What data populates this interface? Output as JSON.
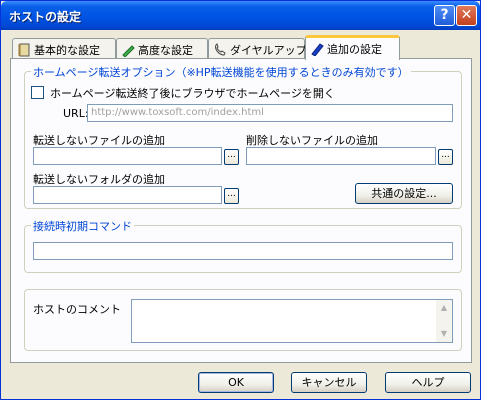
{
  "window": {
    "title": "ホストの設定",
    "help_button": "?",
    "close_button": "✕"
  },
  "tabs": [
    {
      "label": "基本的な設定",
      "icon": "book-icon"
    },
    {
      "label": "高度な設定",
      "icon": "pen-icon"
    },
    {
      "label": "ダイヤルアップ",
      "icon": "phone-icon"
    },
    {
      "label": "追加の設定",
      "icon": "pencil-icon",
      "active": true
    }
  ],
  "hp_group": {
    "label": "ホームページ転送オプション（※HP転送機能を使用するときのみ有効です）",
    "checkbox_label": "ホームページ転送終了後にブラウザでホームページを開く",
    "url_label": "URL:",
    "url_placeholder": "http://www.toxsoft.com/index.html",
    "no_transfer_file_label": "転送しないファイルの追加",
    "no_delete_file_label": "削除しないファイルの追加",
    "no_transfer_folder_label": "転送しないフォルダの追加",
    "browse": "...",
    "common_settings_button": "共通の設定..."
  },
  "init_group": {
    "label": "接続時初期コマンド"
  },
  "comment": {
    "label": "ホストのコメント"
  },
  "footer": {
    "ok": "OK",
    "cancel": "キャンセル",
    "help": "ヘルプ"
  },
  "colors": {
    "title_bar": "#0055e5",
    "group_label": "#0046d5",
    "tab_highlight": "#ffc83c"
  }
}
